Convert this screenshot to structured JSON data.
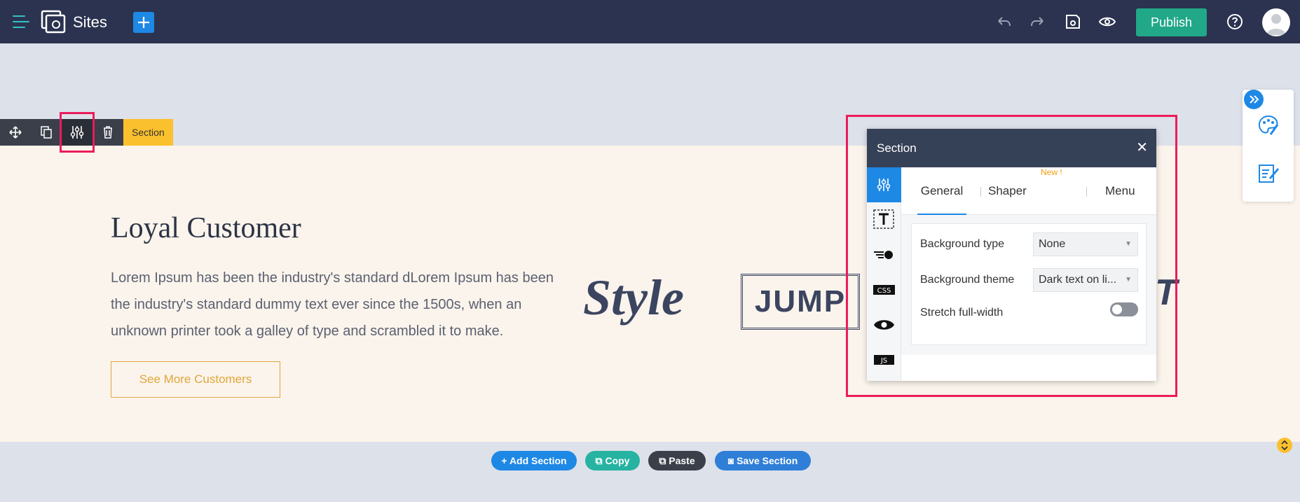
{
  "topbar": {
    "title": "Sites",
    "publish_label": "Publish"
  },
  "section_toolbar": {
    "label": "Section"
  },
  "section": {
    "heading": "Loyal Customer",
    "body": "Lorem Ipsum has been the industry's standard dLorem Ipsum has been the industry's standard dummy text ever since the 1500s, when an unknown printer took a galley of type and scrambled it to make.",
    "cta_label": "See More Customers",
    "logos": {
      "style": "Style",
      "jump": "JUMP",
      "partial": "T"
    }
  },
  "panel": {
    "title": "Section",
    "tabs": [
      {
        "label": "General"
      },
      {
        "label": "Shaper"
      },
      {
        "label": "Menu"
      }
    ],
    "new_badge": "New !",
    "fields": {
      "background_type_label": "Background type",
      "background_type_value": "None",
      "background_theme_label": "Background theme",
      "background_theme_value": "Dark text on li...",
      "stretch_label": "Stretch full-width",
      "stretch_on": false
    },
    "side_icons": [
      "settings-sliders-icon",
      "text-icon",
      "animation-icon",
      "css-icon",
      "visibility-icon",
      "js-icon"
    ],
    "side_text": {
      "css": "CSS",
      "js": "JS"
    }
  },
  "bottom_actions": {
    "add": "Add Section",
    "copy": "Copy",
    "paste": "Paste",
    "save": "Save Section"
  },
  "colors": {
    "topbar_bg": "#2b3350",
    "publish_bg": "#21a888",
    "accent_blue": "#1e88e5",
    "section_bg": "#fbf4ec",
    "highlight": "#ec1c5b",
    "label_yellow": "#fbc02d"
  }
}
